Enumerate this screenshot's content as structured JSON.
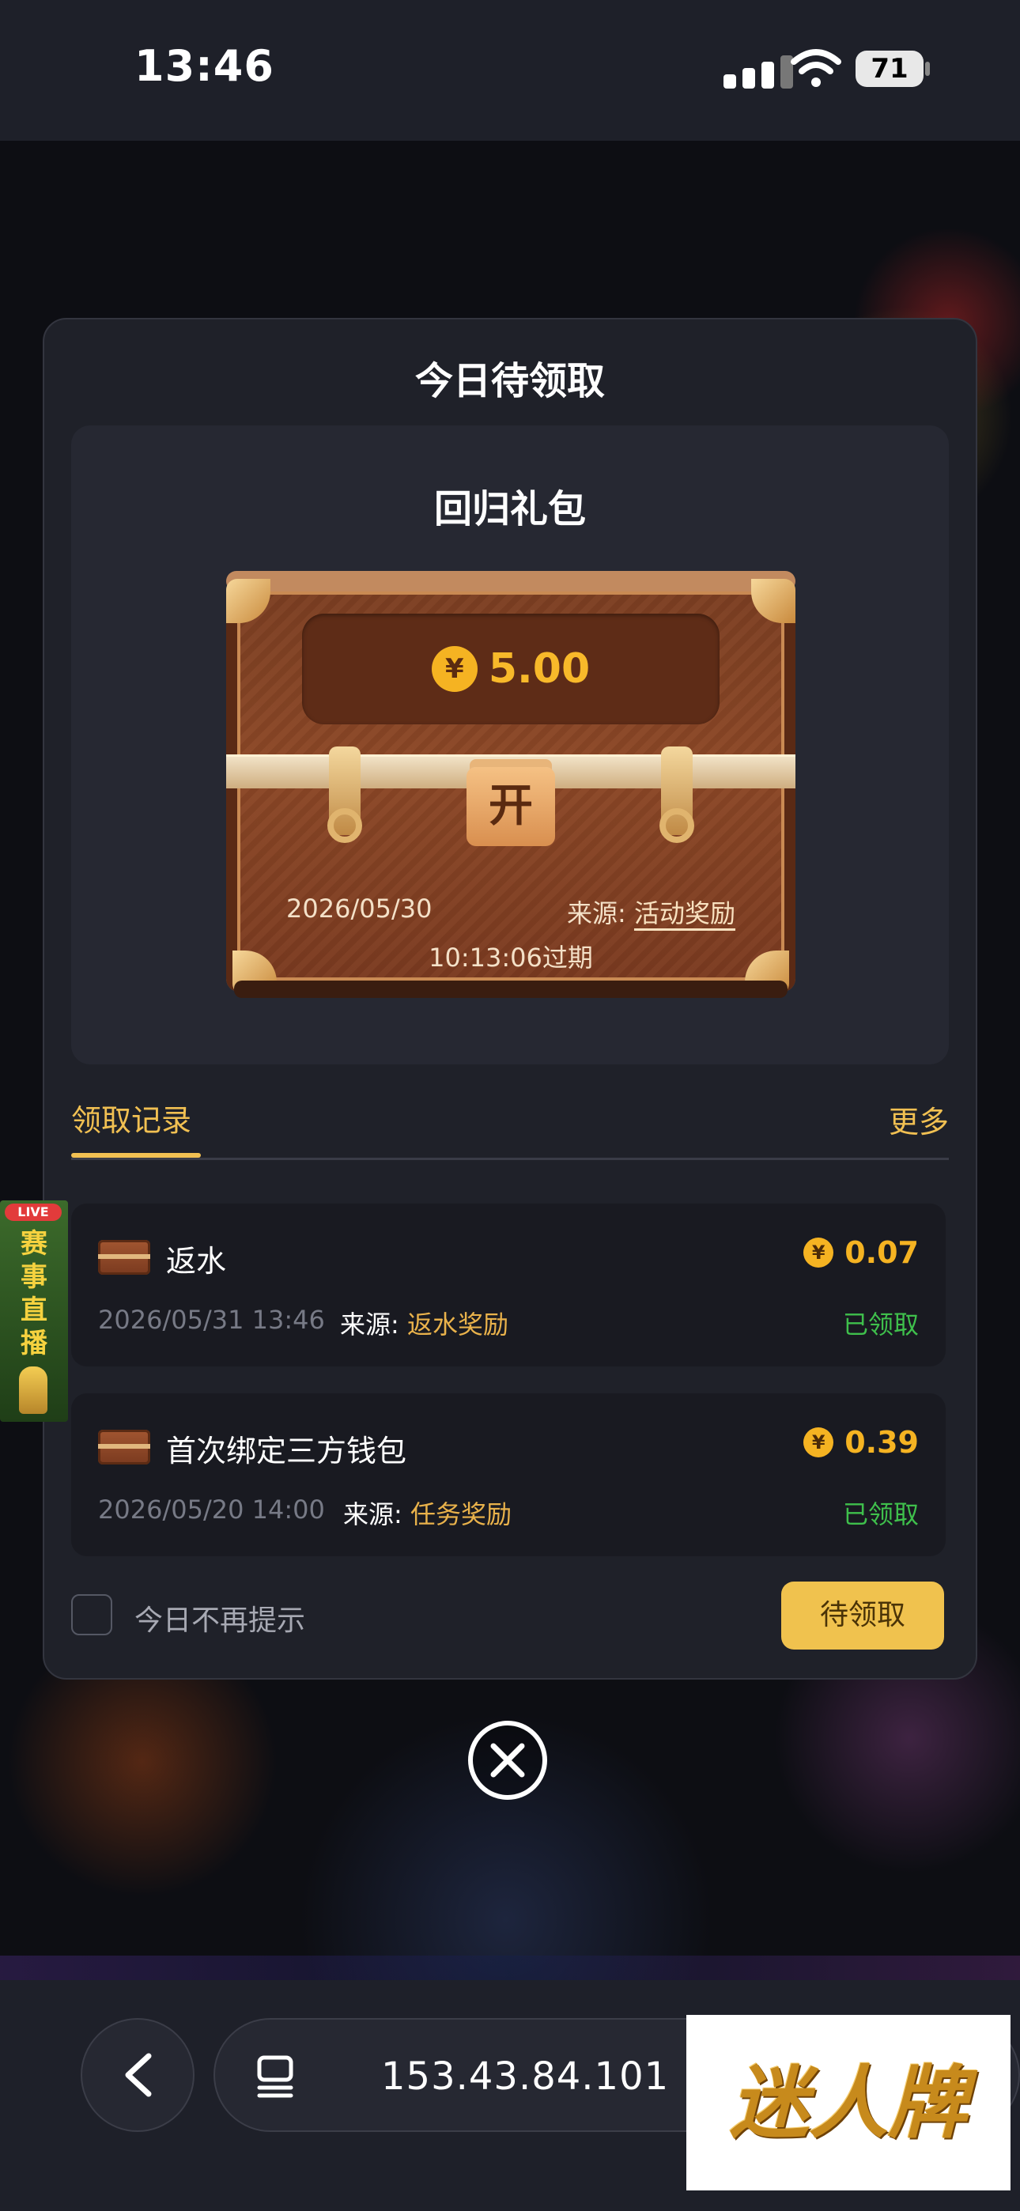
{
  "status_bar": {
    "time": "13:46",
    "battery": "71"
  },
  "modal": {
    "title": "今日待领取",
    "gift": {
      "title": "回归礼包",
      "currency_symbol": "¥",
      "amount": "5.00",
      "open_label": "开",
      "date": "2026/05/30",
      "source_label": "来源:",
      "source_value": "活动奖励",
      "expire": "10:13:06过期"
    },
    "tabs": {
      "records": "领取记录",
      "more": "更多"
    },
    "records": [
      {
        "title": "返水",
        "currency_symbol": "¥",
        "amount": "0.07",
        "date": "2026/05/31 13:46",
        "source_label": "来源:",
        "source_value": "返水奖励",
        "status": "已领取"
      },
      {
        "title": "首次绑定三方钱包",
        "currency_symbol": "¥",
        "amount": "0.39",
        "date": "2026/05/20 14:00",
        "source_label": "来源:",
        "source_value": "任务奖励",
        "status": "已领取"
      }
    ],
    "dont_show_today": "今日不再提示",
    "pending_button": "待领取"
  },
  "live_badge": {
    "tag": "LIVE",
    "text": "赛事直播"
  },
  "browser": {
    "url": "153.43.84.101"
  },
  "brand": {
    "logo_text": "迷人牌"
  },
  "colors": {
    "accent_gold": "#f1c052",
    "amount_orange": "#f5b322",
    "claimed_green": "#3fc04c",
    "modal_bg": "#1f2129"
  }
}
